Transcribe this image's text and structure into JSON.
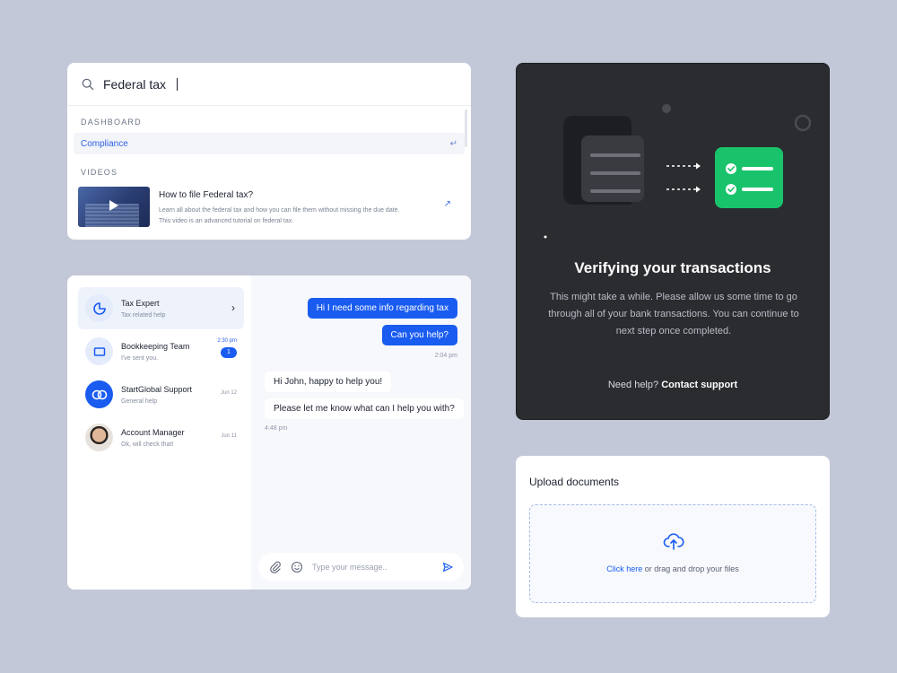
{
  "search": {
    "query": "Federal tax",
    "sections": {
      "dashboard_label": "DASHBOARD",
      "videos_label": "VIDEOS"
    },
    "dashboard_result": "Compliance",
    "enter_symbol": "↵",
    "video": {
      "title": "How to file Federal tax?",
      "desc_line1": "Learn all about the federal tax and how you can file them without missing the due date.",
      "desc_line2": "This video is an advanced tutorial on federal tax.",
      "open_symbol": "↗"
    }
  },
  "chat": {
    "contacts": [
      {
        "name": "Tax Expert",
        "sub": "Tax related help",
        "meta": "",
        "badge": "",
        "active": true
      },
      {
        "name": "Bookkeeping Team",
        "sub": "I've sent you.",
        "meta": "2:30 pm",
        "badge": "1"
      },
      {
        "name": "StartGlobal Support",
        "sub": "General help",
        "meta": "Jun 12",
        "badge": ""
      },
      {
        "name": "Account Manager",
        "sub": "Ok, will check that!",
        "meta": "Jun 11",
        "badge": ""
      }
    ],
    "chevron": "›",
    "messages": {
      "out1": "Hi I need some info regarding tax",
      "out2": "Can you help?",
      "out_time": "2:04 pm",
      "in1": "Hi John, happy to help you!",
      "in2": "Please let me know what can I help you with?",
      "in_time": "4:48 pm"
    },
    "composer_placeholder": "Type your message.."
  },
  "verify": {
    "title": "Verifying your transactions",
    "description": "This might take a while. Please allow us some time to go through all of your bank transactions. You can continue to next step once completed.",
    "help_prefix": "Need help?",
    "help_link": "Contact support"
  },
  "upload": {
    "title": "Upload documents",
    "click_link": "Click here",
    "drop_text": "or drag and drop your files"
  },
  "colors": {
    "accent": "#1a5cf0",
    "success": "#19c36b",
    "dark_card": "#2b2c30",
    "background": "#c3c8d8"
  }
}
